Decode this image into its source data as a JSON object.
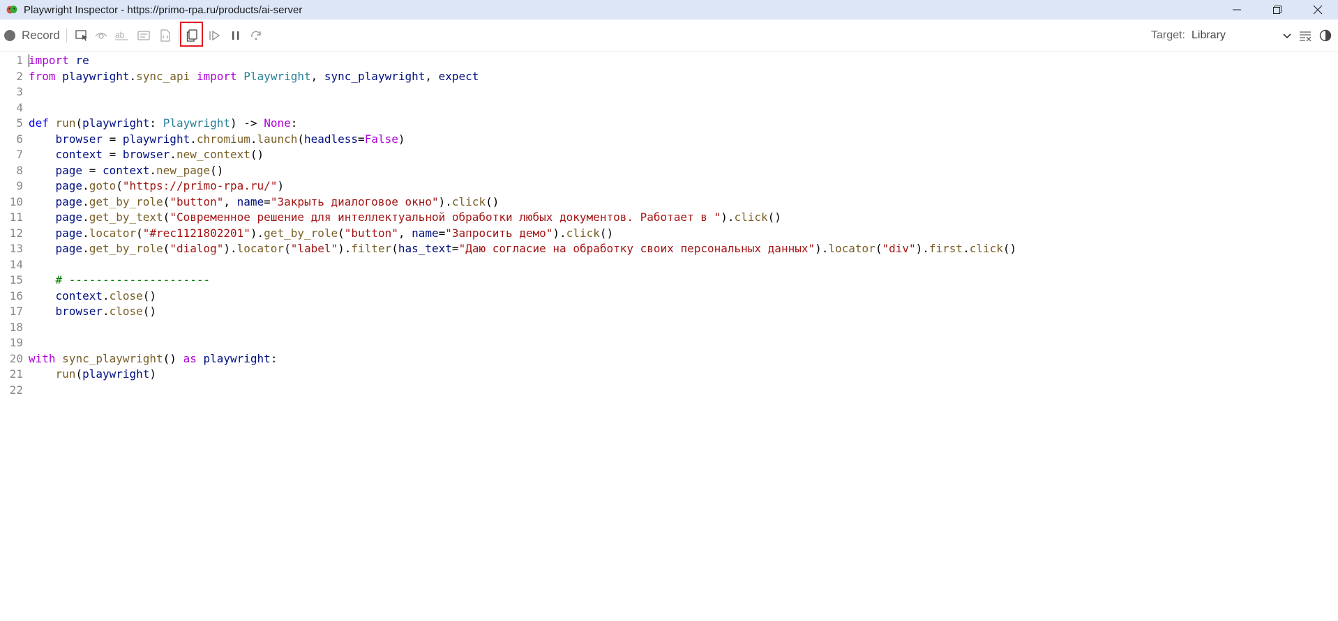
{
  "window": {
    "title": "Playwright Inspector - https://primo-rpa.ru/products/ai-server",
    "controls": [
      "minimize-icon",
      "restore-icon",
      "close-icon"
    ]
  },
  "toolbar": {
    "record_label": "Record",
    "target_label": "Target:",
    "target_value": "Library",
    "icons": [
      "pick-locator-icon",
      "assert-visibility-icon",
      "assert-text-icon",
      "assert-value-icon",
      "assert-snapshot-icon",
      "copy-icon",
      "resume-icon",
      "pause-icon",
      "step-over-icon",
      "clear-icon",
      "theme-toggle-icon"
    ],
    "highlight_color": "#e01b24"
  },
  "editor": {
    "lines": [
      [
        [
          "kw",
          "import"
        ],
        [
          "pn",
          " "
        ],
        [
          "id",
          "re"
        ]
      ],
      [
        [
          "kw",
          "from"
        ],
        [
          "pn",
          " "
        ],
        [
          "id",
          "playwright"
        ],
        [
          "pn",
          "."
        ],
        [
          "fn",
          "sync_api"
        ],
        [
          "pn",
          " "
        ],
        [
          "kw",
          "import"
        ],
        [
          "pn",
          " "
        ],
        [
          "cls",
          "Playwright"
        ],
        [
          "pn",
          ", "
        ],
        [
          "id",
          "sync_playwright"
        ],
        [
          "pn",
          ", "
        ],
        [
          "id",
          "expect"
        ]
      ],
      [],
      [],
      [
        [
          "kw2",
          "def"
        ],
        [
          "pn",
          " "
        ],
        [
          "fn",
          "run"
        ],
        [
          "pn",
          "("
        ],
        [
          "id",
          "playwright"
        ],
        [
          "pn",
          ": "
        ],
        [
          "cls",
          "Playwright"
        ],
        [
          "pn",
          ") -> "
        ],
        [
          "kw",
          "None"
        ],
        [
          "pn",
          ":"
        ]
      ],
      [
        [
          "pn",
          "    "
        ],
        [
          "id",
          "browser"
        ],
        [
          "pn",
          " = "
        ],
        [
          "id",
          "playwright"
        ],
        [
          "pn",
          "."
        ],
        [
          "fn",
          "chromium"
        ],
        [
          "pn",
          "."
        ],
        [
          "fn",
          "launch"
        ],
        [
          "pn",
          "("
        ],
        [
          "id",
          "headless"
        ],
        [
          "pn",
          "="
        ],
        [
          "kw",
          "False"
        ],
        [
          "pn",
          ")"
        ]
      ],
      [
        [
          "pn",
          "    "
        ],
        [
          "id",
          "context"
        ],
        [
          "pn",
          " = "
        ],
        [
          "id",
          "browser"
        ],
        [
          "pn",
          "."
        ],
        [
          "fn",
          "new_context"
        ],
        [
          "pn",
          "()"
        ]
      ],
      [
        [
          "pn",
          "    "
        ],
        [
          "id",
          "page"
        ],
        [
          "pn",
          " = "
        ],
        [
          "id",
          "context"
        ],
        [
          "pn",
          "."
        ],
        [
          "fn",
          "new_page"
        ],
        [
          "pn",
          "()"
        ]
      ],
      [
        [
          "pn",
          "    "
        ],
        [
          "id",
          "page"
        ],
        [
          "pn",
          "."
        ],
        [
          "fn",
          "goto"
        ],
        [
          "pn",
          "("
        ],
        [
          "str",
          "\"https://primo-rpa.ru/\""
        ],
        [
          "pn",
          ")"
        ]
      ],
      [
        [
          "pn",
          "    "
        ],
        [
          "id",
          "page"
        ],
        [
          "pn",
          "."
        ],
        [
          "fn",
          "get_by_role"
        ],
        [
          "pn",
          "("
        ],
        [
          "str",
          "\"button\""
        ],
        [
          "pn",
          ", "
        ],
        [
          "id",
          "name"
        ],
        [
          "pn",
          "="
        ],
        [
          "str",
          "\"Закрыть диалоговое окно\""
        ],
        [
          "pn",
          ")."
        ],
        [
          "fn",
          "click"
        ],
        [
          "pn",
          "()"
        ]
      ],
      [
        [
          "pn",
          "    "
        ],
        [
          "id",
          "page"
        ],
        [
          "pn",
          "."
        ],
        [
          "fn",
          "get_by_text"
        ],
        [
          "pn",
          "("
        ],
        [
          "str",
          "\"Современное решение для интеллектуальной обработки любых документов. Работает в \""
        ],
        [
          "pn",
          ")."
        ],
        [
          "fn",
          "click"
        ],
        [
          "pn",
          "()"
        ]
      ],
      [
        [
          "pn",
          "    "
        ],
        [
          "id",
          "page"
        ],
        [
          "pn",
          "."
        ],
        [
          "fn",
          "locator"
        ],
        [
          "pn",
          "("
        ],
        [
          "str",
          "\"#rec1121802201\""
        ],
        [
          "pn",
          ")."
        ],
        [
          "fn",
          "get_by_role"
        ],
        [
          "pn",
          "("
        ],
        [
          "str",
          "\"button\""
        ],
        [
          "pn",
          ", "
        ],
        [
          "id",
          "name"
        ],
        [
          "pn",
          "="
        ],
        [
          "str",
          "\"Запросить демо\""
        ],
        [
          "pn",
          ")."
        ],
        [
          "fn",
          "click"
        ],
        [
          "pn",
          "()"
        ]
      ],
      [
        [
          "pn",
          "    "
        ],
        [
          "id",
          "page"
        ],
        [
          "pn",
          "."
        ],
        [
          "fn",
          "get_by_role"
        ],
        [
          "pn",
          "("
        ],
        [
          "str",
          "\"dialog\""
        ],
        [
          "pn",
          ")."
        ],
        [
          "fn",
          "locator"
        ],
        [
          "pn",
          "("
        ],
        [
          "str",
          "\"label\""
        ],
        [
          "pn",
          ")."
        ],
        [
          "fn",
          "filter"
        ],
        [
          "pn",
          "("
        ],
        [
          "id",
          "has_text"
        ],
        [
          "pn",
          "="
        ],
        [
          "str",
          "\"Даю согласие на обработку своих персональных данных\""
        ],
        [
          "pn",
          ")."
        ],
        [
          "fn",
          "locator"
        ],
        [
          "pn",
          "("
        ],
        [
          "str",
          "\"div\""
        ],
        [
          "pn",
          ")."
        ],
        [
          "fn",
          "first"
        ],
        [
          "pn",
          "."
        ],
        [
          "fn",
          "click"
        ],
        [
          "pn",
          "()"
        ]
      ],
      [],
      [
        [
          "pn",
          "    "
        ],
        [
          "cm",
          "# ---------------------"
        ]
      ],
      [
        [
          "pn",
          "    "
        ],
        [
          "id",
          "context"
        ],
        [
          "pn",
          "."
        ],
        [
          "fn",
          "close"
        ],
        [
          "pn",
          "()"
        ]
      ],
      [
        [
          "pn",
          "    "
        ],
        [
          "id",
          "browser"
        ],
        [
          "pn",
          "."
        ],
        [
          "fn",
          "close"
        ],
        [
          "pn",
          "()"
        ]
      ],
      [],
      [],
      [
        [
          "kw",
          "with"
        ],
        [
          "pn",
          " "
        ],
        [
          "fn",
          "sync_playwright"
        ],
        [
          "pn",
          "() "
        ],
        [
          "kw",
          "as"
        ],
        [
          "pn",
          " "
        ],
        [
          "id",
          "playwright"
        ],
        [
          "pn",
          ":"
        ]
      ],
      [
        [
          "pn",
          "    "
        ],
        [
          "fn",
          "run"
        ],
        [
          "pn",
          "("
        ],
        [
          "id",
          "playwright"
        ],
        [
          "pn",
          ")"
        ]
      ],
      []
    ]
  }
}
